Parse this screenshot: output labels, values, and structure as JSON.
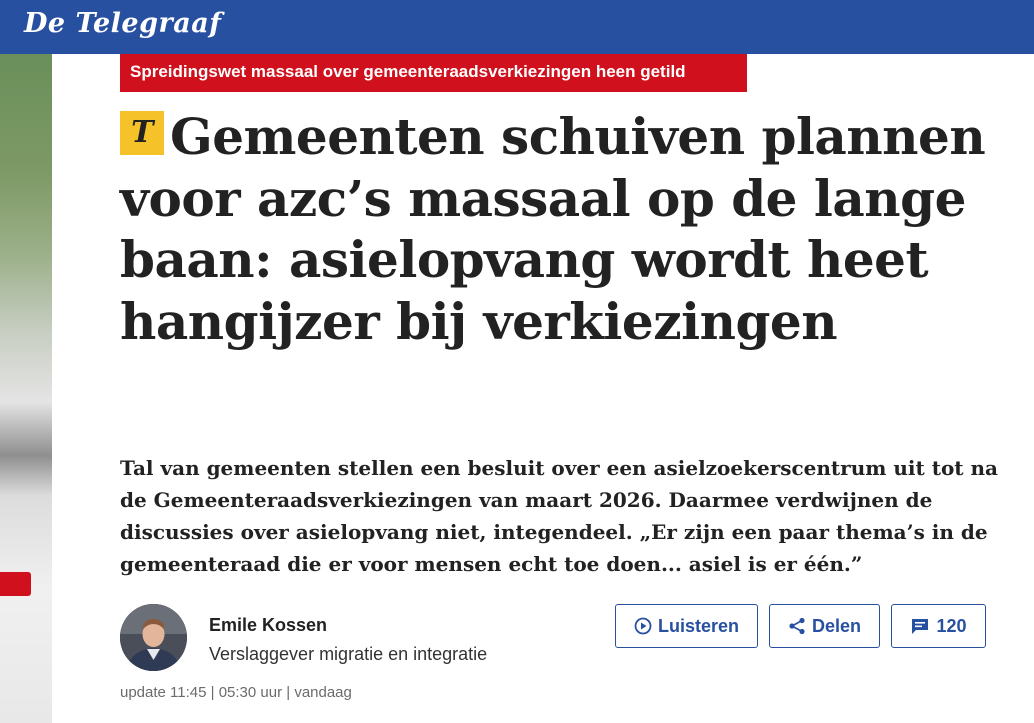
{
  "brand": {
    "name": "De Telegraaf",
    "bar_color": "#2850a0"
  },
  "article": {
    "kicker": "Spreidingswet massaal over gemeenteraadsverkiezingen heen getild",
    "badge_letter": "T",
    "headline": "Gemeenten schuiven plannen voor azc’s massaal op de lange baan: asielopvang wordt heet hangijzer bij verkiezingen",
    "intro": "Tal van gemeenten stellen een besluit over een asielzoekerscentrum uit tot na de Gemeenteraadsverkiezingen van maart 2026. Daarmee verdwijnen de discussies over asielopvang niet, integendeel. „Er zijn een paar thema’s in de gemeenteraad die er voor mensen echt toe doen... asiel is er één.”"
  },
  "author": {
    "name": "Emile Kossen",
    "role": "Verslaggever migratie en integratie"
  },
  "actions": {
    "listen_label": "Luisteren",
    "share_label": "Delen",
    "comments_count": "120"
  },
  "meta": {
    "timestamp": "update 11:45 | 05:30 uur | vandaag"
  },
  "colors": {
    "accent": "#2850a0",
    "kicker_bg": "#d0101c",
    "badge_bg": "#f6c229"
  }
}
